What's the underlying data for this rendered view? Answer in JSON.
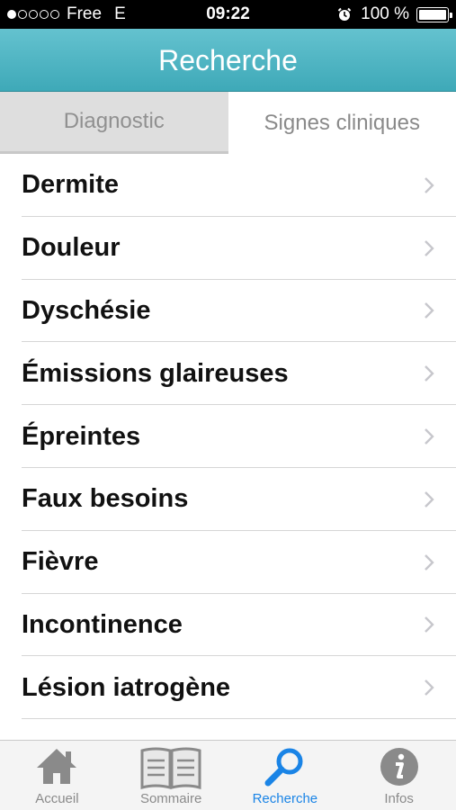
{
  "status_bar": {
    "carrier": "Free",
    "network": "E",
    "time": "09:22",
    "battery": "100 %",
    "battery_level": 1.0,
    "signal_bars_filled": 1,
    "signal_bars_total": 5,
    "icons": [
      "alarm-clock-icon",
      "battery-icon"
    ]
  },
  "nav": {
    "title": "Recherche",
    "color": "#4fb5c3"
  },
  "tabs": [
    {
      "label": "Diagnostic",
      "selected": false
    },
    {
      "label": "Signes cliniques",
      "selected": true
    }
  ],
  "list": {
    "items": [
      {
        "label": "Dermite"
      },
      {
        "label": "Douleur"
      },
      {
        "label": "Dyschésie"
      },
      {
        "label": "Émissions glaireuses"
      },
      {
        "label": "Épreintes"
      },
      {
        "label": "Faux besoins"
      },
      {
        "label": "Fièvre"
      },
      {
        "label": "Incontinence"
      },
      {
        "label": "Lésion iatrogène"
      }
    ]
  },
  "tab_bar": {
    "items": [
      {
        "label": "Accueil",
        "icon": "home-icon",
        "selected": false
      },
      {
        "label": "Sommaire",
        "icon": "book-icon",
        "selected": false
      },
      {
        "label": "Recherche",
        "icon": "search-icon",
        "selected": true
      },
      {
        "label": "Infos",
        "icon": "info-icon",
        "selected": false
      }
    ],
    "accent_color": "#1a84e6",
    "inactive_color": "#8a8a8a"
  }
}
